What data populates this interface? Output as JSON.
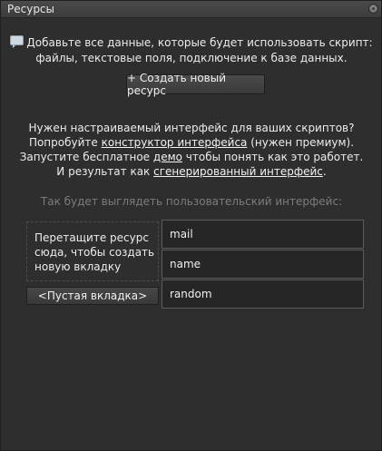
{
  "panel": {
    "title": "Ресурсы",
    "close_icon": "close-circle-icon"
  },
  "info": {
    "icon": "chat-bubble-icon",
    "line1": "Добавьте все данные, которые будет использовать скрипт:",
    "line2": "файлы, текстовые поля, подключение к базе данных."
  },
  "create_button": {
    "label": "+ Создать новый ресурс"
  },
  "promo": {
    "line1": "Нужен настраиваемый интерфейс для ваших скриптов?",
    "line2_before": "Попробуйте ",
    "line2_link": "конструктор интерфейса",
    "line2_after": " (нужен премиум).",
    "line3_before": "Запустите бесплатное ",
    "line3_link": "демо",
    "line3_after": " чтобы понять как это работет.",
    "line4_before": "И результат как ",
    "line4_link": "сгенерированный интерфейс",
    "line4_after": "."
  },
  "preview": {
    "label": "Так будет выглядеть пользовательский интерфейс:",
    "drop_zone_text_1": "Перетащите ресурс",
    "drop_zone_text_2": "сюда, чтобы создать",
    "drop_zone_text_3": "новую вкладку",
    "empty_tab_label": "<Пустая вкладка>",
    "fields": [
      "mail",
      "name",
      "random"
    ]
  }
}
